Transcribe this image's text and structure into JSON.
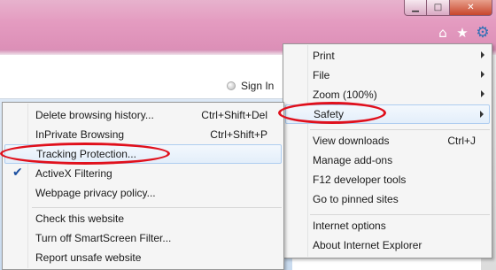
{
  "colors": {
    "chrome_pink": "#e49bc0",
    "menu_bg": "#f5f5f5",
    "highlight": "#aecdf0",
    "annotation_red": "#e0101c",
    "gear_blue": "#2f6fb5"
  },
  "window_controls": {
    "minimize_icon": "minimize-icon",
    "maximize_icon": "maximize-icon",
    "close_icon": "close-icon"
  },
  "toolbar": {
    "home_icon": "home-icon",
    "favorites_icon": "star-icon",
    "tools_icon": "gear-icon"
  },
  "page": {
    "signin_label": "Sign In"
  },
  "main_menu": {
    "items": [
      {
        "label": "Print",
        "submenu": true
      },
      {
        "label": "File",
        "submenu": true
      },
      {
        "label": "Zoom (100%)",
        "submenu": true
      },
      {
        "label": "Safety",
        "submenu": true,
        "highlighted": true,
        "circled": true
      },
      {
        "label": "View downloads",
        "shortcut": "Ctrl+J"
      },
      {
        "label": "Manage add-ons"
      },
      {
        "label": "F12 developer tools"
      },
      {
        "label": "Go to pinned sites"
      },
      {
        "label": "Internet options"
      },
      {
        "label": "About Internet Explorer"
      }
    ]
  },
  "safety_menu": {
    "items": [
      {
        "label": "Delete browsing history...",
        "shortcut": "Ctrl+Shift+Del"
      },
      {
        "label": "InPrivate Browsing",
        "shortcut": "Ctrl+Shift+P"
      },
      {
        "label": "Tracking Protection...",
        "highlighted": true,
        "circled": true
      },
      {
        "label": "ActiveX Filtering",
        "checked": true
      },
      {
        "label": "Webpage privacy policy..."
      },
      {
        "label": "Check this website"
      },
      {
        "label": "Turn off SmartScreen Filter..."
      },
      {
        "label": "Report unsafe website"
      }
    ]
  }
}
